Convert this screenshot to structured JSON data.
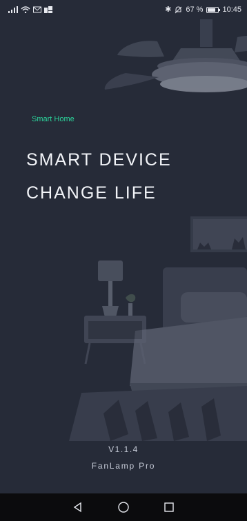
{
  "status_bar": {
    "battery": "67 %",
    "battery_level": 0.67,
    "time": "10:45",
    "icons": [
      "signal-icon",
      "wifi-icon",
      "mail-icon",
      "app-notification-icon",
      "bluetooth-icon",
      "silent-alarm-icon",
      "battery-icon"
    ]
  },
  "splash": {
    "tag": "Smart Home",
    "headline_line1": "SMART DEVICE",
    "headline_line2": "CHANGE LIFE",
    "version": "V1.1.4",
    "app_name": "FanLamp Pro"
  },
  "nav_bar": {
    "icons": [
      "back-icon",
      "home-icon",
      "recents-icon"
    ]
  },
  "colors": {
    "background": "#262b38",
    "accent": "#2bd49b",
    "text": "#f2f4f8",
    "nav_background": "#0b0b0d"
  }
}
